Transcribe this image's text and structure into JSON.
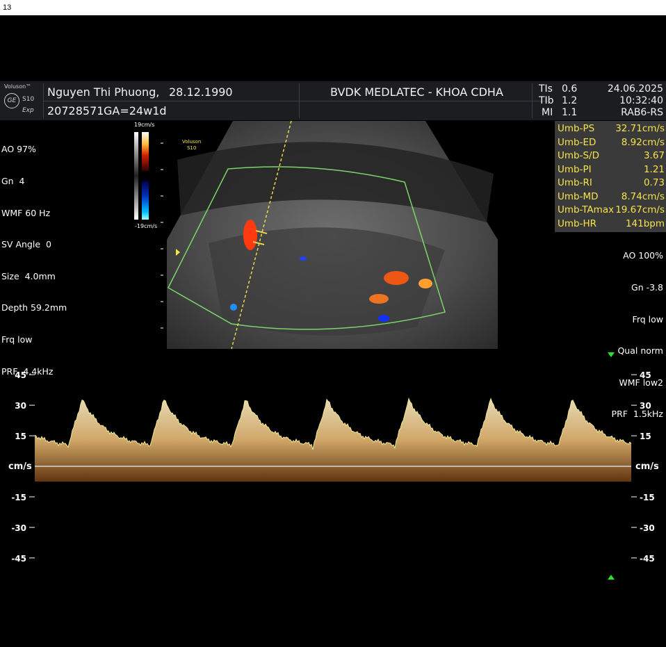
{
  "frame_number": "13",
  "logo": {
    "brand": "Voluson™",
    "model": "S10",
    "mode": "Exp",
    "emblem": "GE"
  },
  "patient": {
    "name": "Nguyen Thi Phuong,",
    "dob": "28.12.1990",
    "id": "20728571",
    "ga": "GA=24w1d"
  },
  "institution": "BVDK MEDLATEC - KHOA CDHA",
  "indices": [
    {
      "label": "TIs",
      "value": "0.6"
    },
    {
      "label": "TIb",
      "value": "1.2"
    },
    {
      "label": "MI",
      "value": "1.1"
    }
  ],
  "date": "24.06.2025",
  "time": "10:32:40",
  "probe": "RAB6-RS",
  "left_params": [
    "AO 97%",
    "Gn  4",
    "WMF 60 Hz",
    "SV Angle  0",
    "Size  4.0mm",
    "Depth 59.2mm",
    "Frq low",
    "PRF  4.4kHz"
  ],
  "measurements": [
    {
      "label": "Umb-PS",
      "value": "32.71cm/s"
    },
    {
      "label": "Umb-ED",
      "value": "8.92cm/s"
    },
    {
      "label": "Umb-S/D",
      "value": "3.67"
    },
    {
      "label": "Umb-PI",
      "value": "1.21"
    },
    {
      "label": "Umb-RI",
      "value": "0.73"
    },
    {
      "label": "Umb-MD",
      "value": "8.74cm/s"
    },
    {
      "label": "Umb-TAmax",
      "value": "19.67cm/s"
    },
    {
      "label": "Umb-HR",
      "value": "141bpm"
    }
  ],
  "right_params": [
    "AO 100%",
    "Gn -3.8",
    "Frq low",
    "Qual norm",
    "WMF low2",
    "PRF  1.5kHz"
  ],
  "color_scale": {
    "top": "19cm/s",
    "bottom": "-19cm/s"
  },
  "image_mark": [
    "Voluson",
    "S10"
  ],
  "doppler": {
    "unit": "cm/s",
    "ticks": [
      45,
      30,
      15,
      -15,
      -30,
      -45
    ],
    "tick_labels": [
      "45",
      "30",
      "15",
      "-15",
      "-30",
      "-45"
    ],
    "peak_velocity": 32.71,
    "end_diastolic_velocity": 8.92,
    "cycles": 7
  },
  "colors": {
    "header_bg": "#1b1d20",
    "measure_text": "#f7e34b",
    "trace": "#f0cf8a",
    "roi": "#7bd66a",
    "spectral": "#e8b974"
  }
}
